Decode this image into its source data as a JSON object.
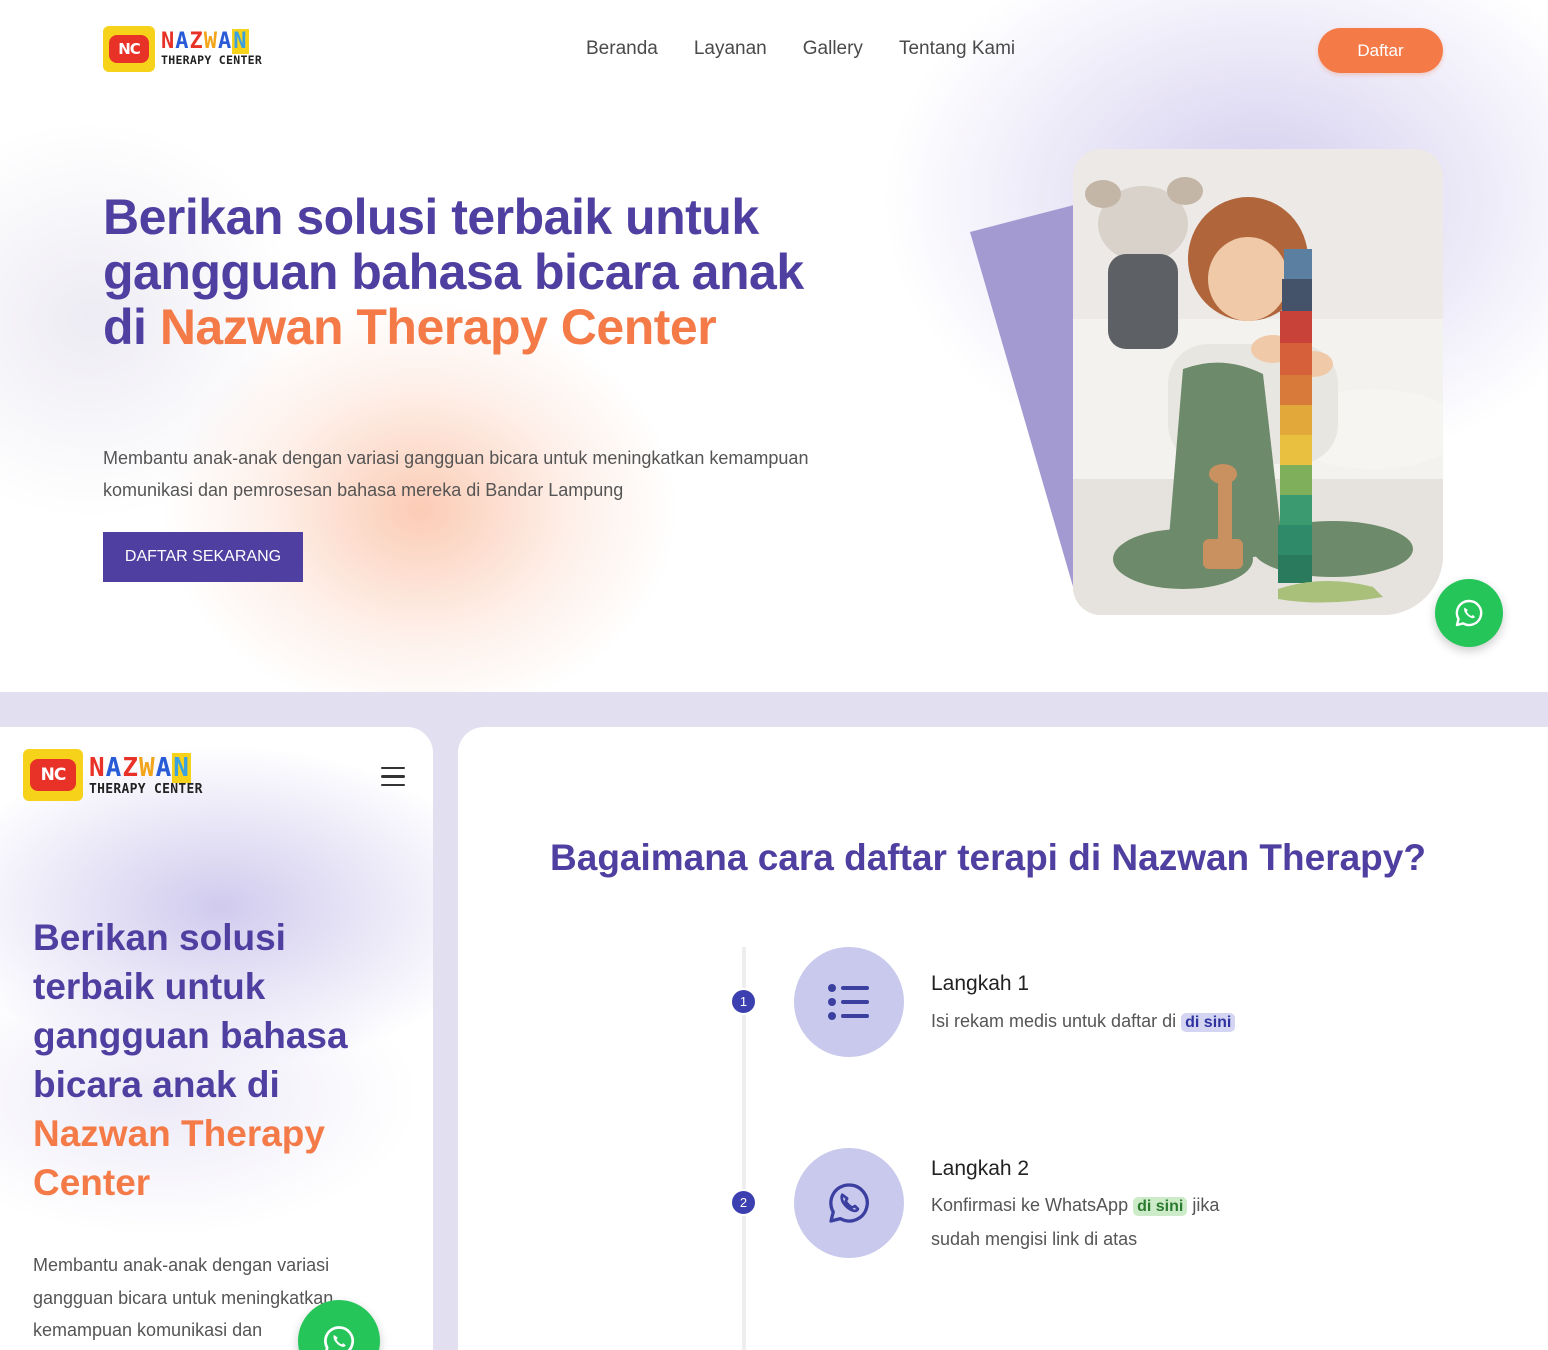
{
  "brand": {
    "logo_initials": "NC",
    "logo_name": [
      "N",
      "A",
      "Z",
      "W",
      "A",
      "N"
    ],
    "logo_subtitle": "THERAPY CENTER"
  },
  "nav": {
    "items": [
      "Beranda",
      "Layanan",
      "Gallery",
      "Tentang Kami"
    ],
    "cta_label": "Daftar"
  },
  "hero": {
    "title_main": "Berikan solusi terbaik untuk gangguan bahasa bicara anak di ",
    "title_highlight": "Nazwan Therapy Center",
    "description": "Membantu anak-anak dengan variasi gangguan bicara untuk meningkatkan kemampuan komunikasi dan pemrosesan bahasa mereka di Bandar Lampung",
    "cta_label": "DAFTAR SEKARANG",
    "image_alt": "child-stacking-blocks-photo"
  },
  "mobile_preview": {
    "title_main": "Berikan solusi terbaik untuk gangguan bahasa bicara anak di ",
    "title_highlight": "Nazwan Therapy Center",
    "description": "Membantu anak-anak dengan variasi gangguan bicara untuk meningkatkan kemampuan komunikasi dan"
  },
  "registration": {
    "title": "Bagaimana cara daftar terapi di Nazwan Therapy?",
    "steps": [
      {
        "number": "1",
        "icon": "list-icon",
        "label": "Langkah 1",
        "text_before": "Isi rekam medis untuk daftar di",
        "link": "di sini",
        "text_after": ""
      },
      {
        "number": "2",
        "icon": "whatsapp-icon",
        "label": "Langkah 2",
        "text_before": "Konfirmasi ke WhatsApp",
        "link": "di sini",
        "text_after": "jika sudah mengisi link di atas"
      }
    ]
  },
  "colors": {
    "primary_purple": "#4e3fa0",
    "accent_orange": "#f47a48",
    "whatsapp_green": "#25c55a",
    "section_bg": "#e2e0f0"
  }
}
